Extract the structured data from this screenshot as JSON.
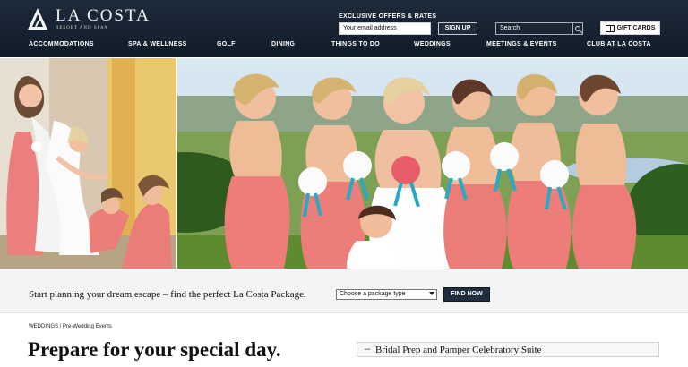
{
  "brand": {
    "name": "LA COSTA",
    "subtitle": "RESORT AND SPA®"
  },
  "offers": {
    "label": "EXCLUSIVE OFFERS & RATES",
    "email_placeholder": "Your email address",
    "signup_label": "SIGN UP"
  },
  "search": {
    "placeholder": "Search"
  },
  "gift": {
    "label": "GIFT CARDS"
  },
  "nav": {
    "items": [
      {
        "label": "ACCOMMODATIONS"
      },
      {
        "label": "SPA & WELLNESS"
      },
      {
        "label": "GOLF"
      },
      {
        "label": "DINING"
      },
      {
        "label": "THINGS TO DO"
      },
      {
        "label": "WEDDINGS"
      },
      {
        "label": "MEETINGS & EVENTS"
      },
      {
        "label": "CLUB AT LA COSTA"
      }
    ]
  },
  "package": {
    "prompt": "Start planning your dream escape – find the perfect La Costa Package.",
    "select_value": "Choose a package type",
    "button_label": "FIND NOW"
  },
  "breadcrumb": {
    "section": "WEDDINGS",
    "separator": "/",
    "page": "Pre-Wedding Events"
  },
  "page": {
    "title": "Prepare for your special day."
  },
  "suite": {
    "marker": "–",
    "title": "Bridal Prep and Pamper Celebratory Suite"
  },
  "colors": {
    "header": "#151f2c",
    "accent_dress": "#ee7e7b",
    "bouquet_ribbon": "#2aa8c4"
  }
}
